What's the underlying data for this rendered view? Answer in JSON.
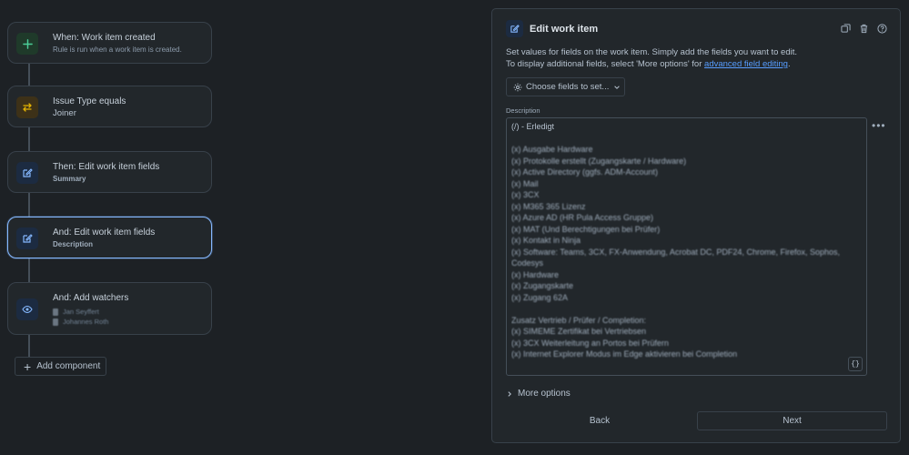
{
  "flow": {
    "nodes": [
      {
        "title": "When: Work item created",
        "subtitle": "Rule is run when a work item is created.",
        "icon": "plus-icon",
        "color": "#4bce97"
      },
      {
        "title": "Issue Type equals",
        "subtitle": "Joiner",
        "icon": "branch-arrows-icon",
        "color": "#e2b203"
      },
      {
        "title": "Then: Edit work item fields",
        "subtitle": "Summary",
        "icon": "edit-icon",
        "color": "#85b8ff"
      },
      {
        "title": "And: Edit work item fields",
        "subtitle": "Description",
        "icon": "edit-icon",
        "color": "#85b8ff"
      },
      {
        "title": "And: Add watchers",
        "icon": "eye-icon",
        "color": "#85b8ff",
        "watchers": [
          "Jan Seyffert",
          "Johannes Roth"
        ]
      }
    ],
    "add_component_label": "Add component"
  },
  "panel": {
    "title": "Edit work item",
    "description_line1": "Set values for fields on the work item. Simply add the fields you want to edit.",
    "description_line2_prefix": "To display additional fields, select 'More options' for ",
    "description_link": "advanced field editing",
    "description_line2_suffix": ".",
    "choose_fields_label": "Choose fields to set...",
    "field_label": "Description",
    "description_lines": [
      "(/) - Erledigt",
      "",
      "(x) Ausgabe Hardware",
      "(x) Protokolle erstellt (Zugangskarte / Hardware)",
      "(x) Active Directory (ggfs. ADM-Account)",
      "(x) Mail",
      "(x) 3CX",
      "(x) M365 365 Lizenz",
      "(x) Azure AD (HR Pula Access Gruppe)",
      "(x) MAT (Und Berechtigungen bei Prüfer)",
      "(x) Kontakt in Ninja",
      "(x) Software: Teams, 3CX, FX-Anwendung, Acrobat DC, PDF24, Chrome, Firefox, Sophos,",
      "Codesys",
      "(x) Hardware",
      "(x) Zugangskarte",
      "(x) Zugang 62A",
      "",
      "Zusatz Vertrieb / Prüfer / Completion:",
      "(x) SIMEME Zertifikat bei Vertriebsen",
      "(x) 3CX Weiterleitung an Portos bei Prüfern",
      "(x) Internet Explorer Modus im Edge aktivieren bei Completion"
    ],
    "brace_label": "{}",
    "more_options_label": "More options",
    "back_label": "Back",
    "next_label": "Next"
  }
}
